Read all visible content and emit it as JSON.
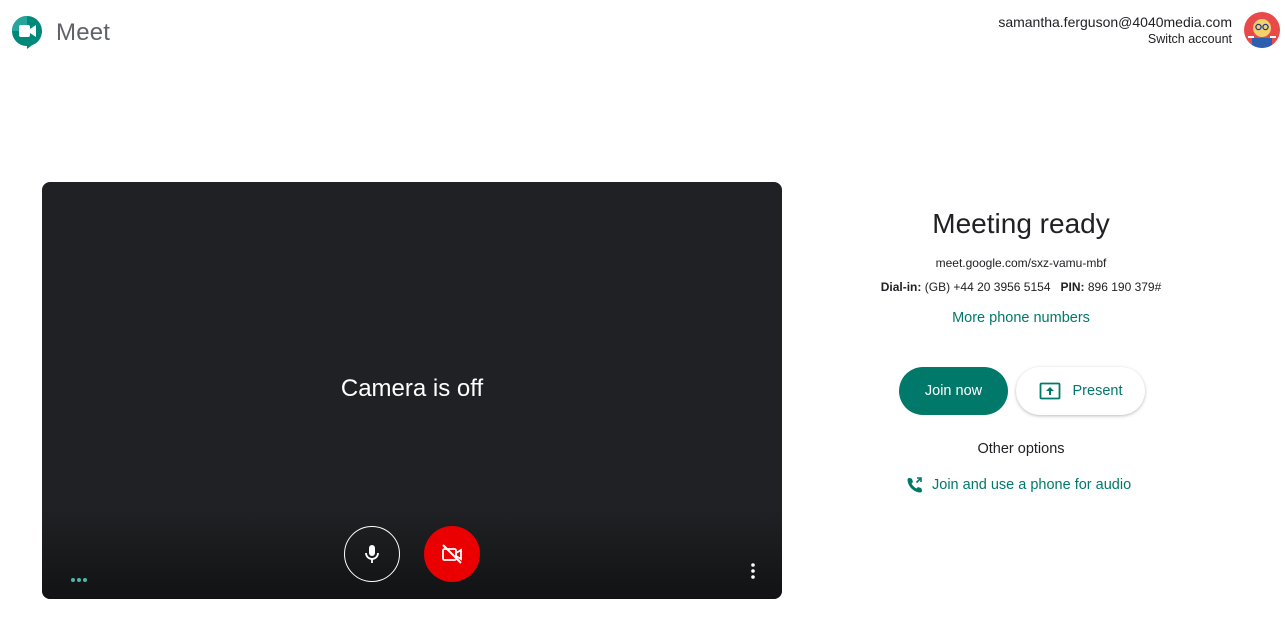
{
  "header": {
    "brand": "Meet",
    "account_email": "samantha.ferguson@4040media.com",
    "switch_account": "Switch account"
  },
  "preview": {
    "camera_status": "Camera is off",
    "mic_state": "on",
    "camera_state": "off"
  },
  "meeting": {
    "title": "Meeting ready",
    "link": "meet.google.com/sxz-vamu-mbf",
    "dial_label": "Dial-in:",
    "dial_number": "(GB) +44 20 3956 5154",
    "pin_label": "PIN:",
    "pin": "896 190 379#",
    "more_numbers": "More phone numbers"
  },
  "actions": {
    "join_now": "Join now",
    "present": "Present",
    "other_options": "Other options",
    "phone_audio": "Join and use a phone for audio"
  },
  "colors": {
    "accent": "#00796b",
    "camera_off_red": "#ea0000",
    "preview_bg": "#202124"
  },
  "icons": [
    "meet-logo-icon",
    "microphone-icon",
    "camera-off-icon",
    "more-dots-icon",
    "more-vertical-icon",
    "present-screen-icon",
    "phone-forward-icon",
    "avatar"
  ]
}
